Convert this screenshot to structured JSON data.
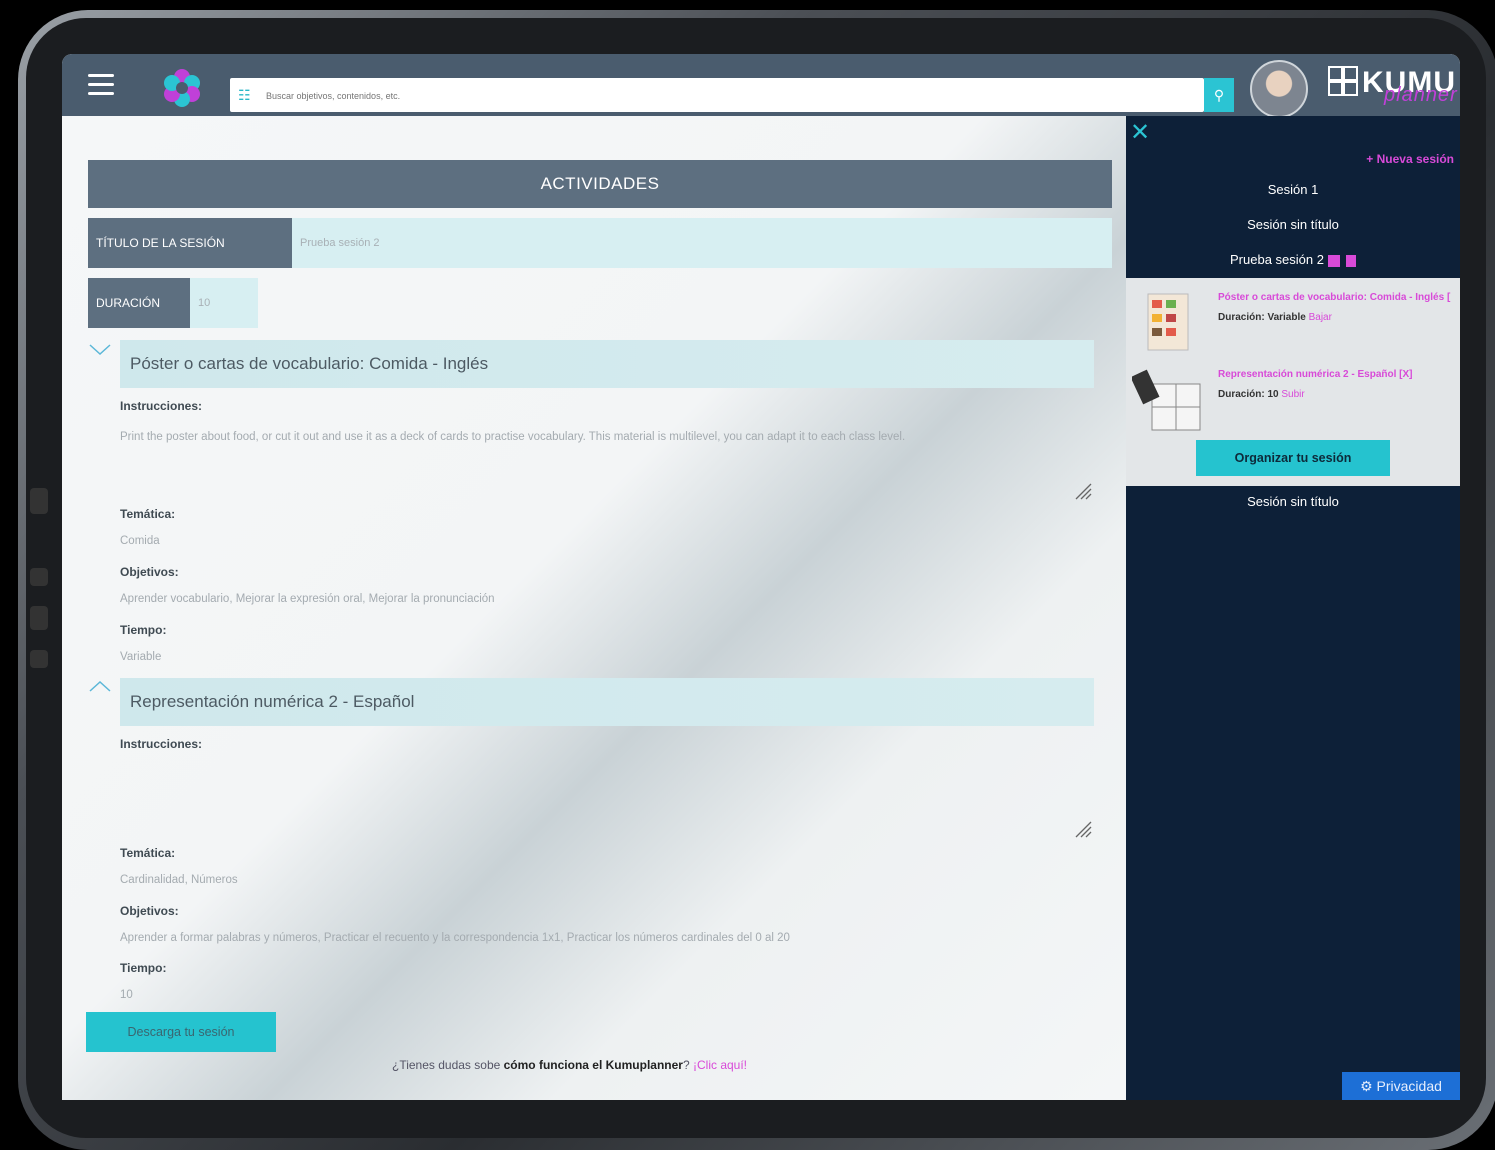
{
  "header": {
    "search_placeholder": "Buscar objetivos, contenidos, etc.",
    "brand": "KUMU",
    "brand_sub": "planner"
  },
  "main": {
    "section_title": "ACTIVIDADES",
    "session_title_label": "TÍTULO DE LA SESIÓN",
    "session_title_value": "Prueba sesión 2",
    "duration_label": "DURACIÓN",
    "duration_value": "10",
    "activities": [
      {
        "title": "Póster o cartas de vocabulario: Comida - Inglés",
        "instructions_label": "Instrucciones:",
        "instructions": "Print the poster about food, or cut it out and use it as a deck of cards to practise vocabulary. This material is multilevel, you can adapt it to each class level.",
        "tematica_label": "Temática:",
        "tematica": "Comida",
        "objetivos_label": "Objetivos:",
        "objetivos": "Aprender vocabulario, Mejorar la expresión oral, Mejorar la pronunciación",
        "tiempo_label": "Tiempo:",
        "tiempo": "Variable"
      },
      {
        "title": "Representación numérica 2 - Español",
        "instructions_label": "Instrucciones:",
        "instructions": "",
        "tematica_label": "Temática:",
        "tematica": "Cardinalidad, Números",
        "objetivos_label": "Objetivos:",
        "objetivos": "Aprender a formar palabras y números, Practicar el recuento y la correspondencia 1x1, Practicar los números cardinales del 0 al 20",
        "tiempo_label": "Tiempo:",
        "tiempo": "10"
      }
    ],
    "download_button": "Descarga tu sesión",
    "help_prefix": "¿Tienes dudas sobe ",
    "help_bold": "cómo funciona el Kumuplanner",
    "help_q": "? ",
    "help_link": "¡Clic aquí!"
  },
  "sidebar": {
    "close": "✕",
    "new_session": "+ Nueva sesión",
    "sessions": [
      "Sesión 1",
      "Sesión sin título",
      "Prueba sesión 2"
    ],
    "session_activities": [
      {
        "title": "Póster o cartas de vocabulario: Comida - Inglés [",
        "duration_label": "Duración:",
        "duration": "Variable",
        "action": "Bajar"
      },
      {
        "title": "Representación numérica 2 - Español [X]",
        "duration_label": "Duración:",
        "duration": "10",
        "action": "Subir"
      }
    ],
    "organize_button": "Organizar tu sesión",
    "last_session": "Sesión sin título",
    "privacy": "Privacidad"
  },
  "colors": {
    "accent": "#25c3cf",
    "magenta": "#d84ad8",
    "topbar": "#4a5c6e",
    "sidebar": "#0d2038"
  }
}
